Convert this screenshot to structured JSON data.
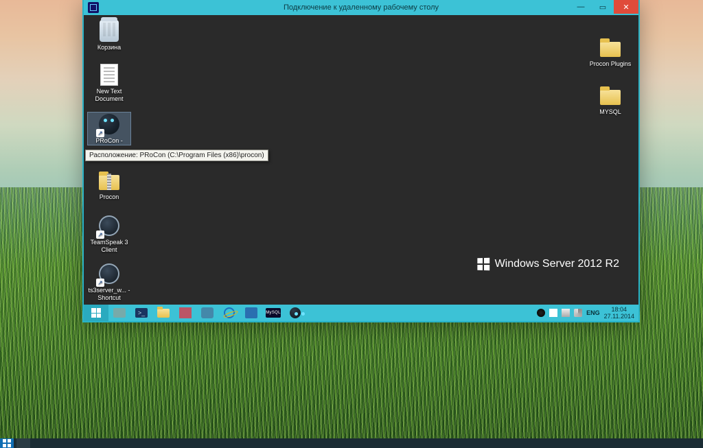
{
  "rdp": {
    "title": "Подключение к удаленному рабочему столу"
  },
  "remote": {
    "branding": "Windows Server 2012 R2",
    "icons": {
      "recycle": "Корзина",
      "newtext": "New Text Document",
      "procon_app": "PRoCon -",
      "procon_folder": "Procon",
      "teamspeak": "TeamSpeak 3 Client",
      "ts3server": "ts3server_w... - Shortcut",
      "procon_plugins": "Procon Plugins",
      "mysql": "MYSQL"
    },
    "tooltip": "Расположение: PRoCon (C:\\Program Files (x86)\\procon)",
    "taskbar": {
      "mysql_label": "MySQL"
    },
    "tray": {
      "lang": "ENG",
      "time": "18:04",
      "date": "27.11.2014"
    }
  }
}
